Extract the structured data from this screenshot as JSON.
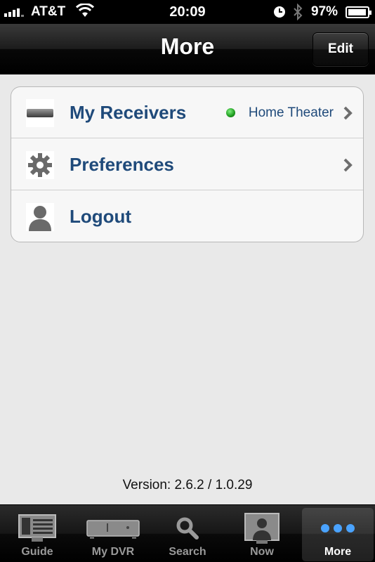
{
  "status_bar": {
    "carrier": "AT&T",
    "time": "20:09",
    "battery_percent": "97%",
    "battery_level": 0.97,
    "signal_bars": 4
  },
  "nav": {
    "title": "More",
    "edit_label": "Edit"
  },
  "menu": {
    "items": [
      {
        "label": "My Receivers",
        "detail": "Home Theater",
        "icon": "receiver-icon",
        "status_color": "#2ea52e"
      },
      {
        "label": "Preferences",
        "detail": "",
        "icon": "gear-icon"
      },
      {
        "label": "Logout",
        "detail": "",
        "icon": "person-icon"
      }
    ]
  },
  "version_text": "Version: 2.6.2 / 1.0.29",
  "tabs": [
    {
      "label": "Guide",
      "icon": "guide-icon",
      "active": false
    },
    {
      "label": "My DVR",
      "icon": "dvr-icon",
      "active": false
    },
    {
      "label": "Search",
      "icon": "search-icon",
      "active": false
    },
    {
      "label": "Now",
      "icon": "now-icon",
      "active": false
    },
    {
      "label": "More",
      "icon": "more-dots-icon",
      "active": true
    }
  ],
  "colors": {
    "label_blue": "#1f4a7a",
    "active_dots": "#4aa3ff"
  }
}
